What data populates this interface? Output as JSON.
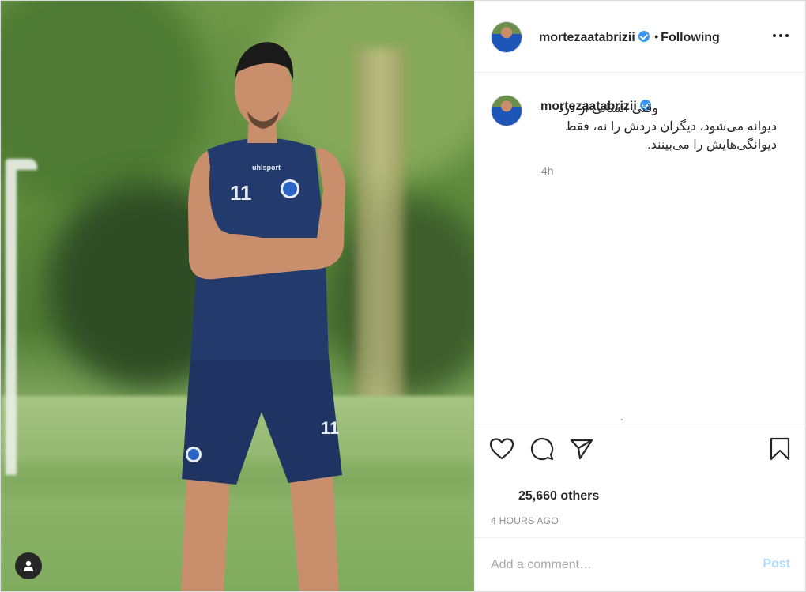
{
  "post": {
    "username": "mortezaatabrizii",
    "verified": true,
    "follow_status": "Following",
    "separator": "•",
    "caption": "وقتی انسانی از درد دیوانه می‌شود، دیگران دردش را نه، فقط دیوانگی‌هایش را می‌بینند.",
    "caption_time": "4h",
    "likes_text": "25,660 others",
    "posted_ago": "4 HOURS AGO"
  },
  "comment": {
    "placeholder": "Add a comment…",
    "post_label": "Post"
  },
  "colors": {
    "verified_badge": "#3897f0",
    "post_button_disabled": "#b3dbff",
    "muted_text": "#8e8e8e",
    "divider": "#efefef"
  },
  "icons": {
    "like": "heart-icon",
    "comment": "comment-icon",
    "share": "paper-plane-icon",
    "save": "bookmark-icon",
    "more": "ellipsis-icon",
    "verified": "verified-badge-icon",
    "user_tag": "user-icon"
  }
}
